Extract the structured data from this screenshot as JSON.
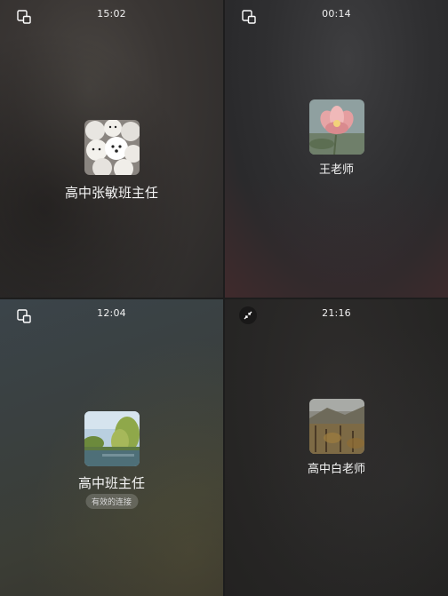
{
  "tiles": {
    "top_left": {
      "time": "15:02",
      "name": "高中张敏班主任",
      "corner_icon": "switch-window-icon",
      "avatar": "samoyed-dogs-avatar"
    },
    "top_right": {
      "time": "00:14",
      "name": "王老师",
      "corner_icon": "switch-window-icon",
      "avatar": "lotus-flower-avatar"
    },
    "bottom_left": {
      "time": "12:04",
      "name": "高中班主任",
      "status": "有效的连接",
      "corner_icon": "switch-window-icon",
      "avatar": "lake-trees-avatar"
    },
    "bottom_right": {
      "time": "21:16",
      "name": "高中白老师",
      "corner_icon": "minimize-arrows-icon",
      "avatar": "autumn-landscape-avatar"
    }
  }
}
